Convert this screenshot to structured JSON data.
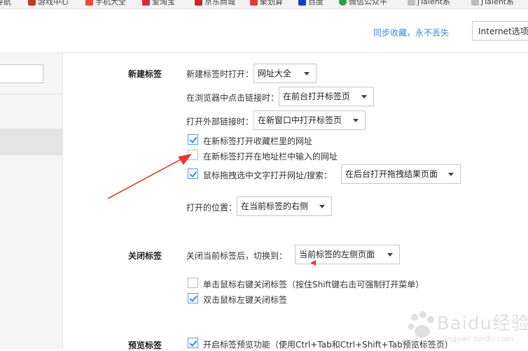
{
  "bookmarks": [
    {
      "label": "导航",
      "color": "#8a8a8a"
    },
    {
      "label": "游戏中心",
      "color": "#c0392b"
    },
    {
      "label": "手机大全",
      "color": "#e74c3c"
    },
    {
      "label": "爱淘宝",
      "color": "#d32f2f"
    },
    {
      "label": "京东商城",
      "color": "#c62828"
    },
    {
      "label": "聚划算",
      "color": "#e53935"
    },
    {
      "label": "百度",
      "color": "#1e3fb8"
    },
    {
      "label": "微信公众平",
      "color": "#2ea043"
    },
    {
      "label": "JTalent系",
      "color": "#9e9e9e"
    },
    {
      "label": "JTalent系",
      "color": "#9e9e9e"
    }
  ],
  "header": {
    "sync_link": "同步收藏，永不丢失",
    "ie_button": "Internet选项"
  },
  "new_tab": {
    "section": "新建标签",
    "open_label": "新建标签时打开：",
    "open_value": "网址大全",
    "click_link_label": "在浏览器中点击链接时：",
    "click_link_value": "在前台打开标签页",
    "external_label": "打开外部链接时：",
    "external_value": "在新窗口中打开标签页",
    "cb_favorites": "在新标签打开收藏栏里的网址",
    "cb_address": "在新标签打开在地址栏中输入的网址",
    "cb_drag": "鼠标拖拽选中文字打开网址/搜索：",
    "drag_value": "在后台打开拖拽结果页面",
    "position_label": "打开的位置：",
    "position_value": "在当前标签的右侧"
  },
  "close_tab": {
    "section": "关闭标签",
    "switch_label": "关闭当前标签后，切换到：",
    "switch_value": "当前标签的左侧页面",
    "cb_right_click": "单击鼠标右键关闭标签（按住Shift键右击可强制打开菜单）",
    "cb_double_click": "双击鼠标左键关闭标签"
  },
  "preview_tab": {
    "section": "预览标签",
    "cb_preview": "开启标签预览功能（使用Ctrl+Tab和Ctrl+Shift+Tab预览标签页）"
  },
  "checkboxes": {
    "favorites": true,
    "address": false,
    "drag": true,
    "right_click": false,
    "double_click": true,
    "preview": true
  },
  "watermark": {
    "text": "Baidu经验",
    "url": "jingyan.baidu.com"
  },
  "colors": {
    "accent": "#3c86d6",
    "annotation": "#e53935"
  }
}
